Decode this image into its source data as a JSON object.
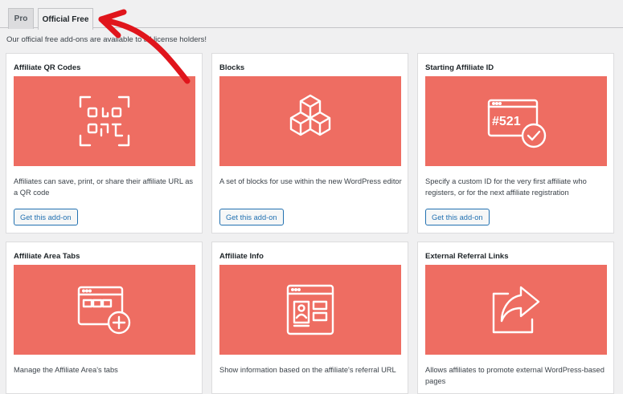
{
  "tabs": [
    {
      "label": "Pro",
      "active": false
    },
    {
      "label": "Official Free",
      "active": true
    }
  ],
  "intro_text": "Our official free add-ons are available to all license holders!",
  "cards": [
    {
      "title": "Affiliate QR Codes",
      "icon": "qr-code-icon",
      "description": "Affiliates can save, print, or share their affiliate URL as a QR code",
      "button": "Get this add-on"
    },
    {
      "title": "Blocks",
      "icon": "blocks-icon",
      "description": "A set of blocks for use within the new WordPress editor",
      "button": "Get this add-on"
    },
    {
      "title": "Starting Affiliate ID",
      "icon": "id-521-check-icon",
      "description": "Specify a custom ID for the very first affiliate who registers, or for the next affiliate registration",
      "button": "Get this add-on",
      "icon_text": "#521"
    },
    {
      "title": "Affiliate Area Tabs",
      "icon": "window-tabs-plus-icon",
      "description": "Manage the Affiliate Area's tabs"
    },
    {
      "title": "Affiliate Info",
      "icon": "window-profile-icon",
      "description": "Show information based on the affiliate's referral URL"
    },
    {
      "title": "External Referral Links",
      "icon": "share-arrow-icon",
      "description": "Allows affiliates to promote external WordPress-based pages"
    }
  ],
  "colors": {
    "card_image_bg": "#ee6d62",
    "annotation_arrow": "#e0151c",
    "button_accent": "#2271b1"
  }
}
